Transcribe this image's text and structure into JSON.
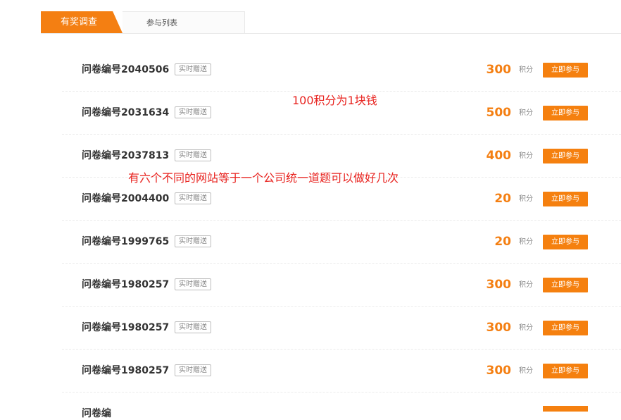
{
  "tabs": {
    "active": "有奖调查",
    "inactive": "参与列表"
  },
  "rows": [
    {
      "title": "问卷编号2040506",
      "tag": "实时赠送",
      "points": "300",
      "unit": "积分",
      "button": "立即参与"
    },
    {
      "title": "问卷编号2031634",
      "tag": "实时赠送",
      "points": "500",
      "unit": "积分",
      "button": "立即参与"
    },
    {
      "title": "问卷编号2037813",
      "tag": "实时赠送",
      "points": "400",
      "unit": "积分",
      "button": "立即参与"
    },
    {
      "title": "问卷编号2004400",
      "tag": "实时赠送",
      "points": "20",
      "unit": "积分",
      "button": "立即参与"
    },
    {
      "title": "问卷编号1999765",
      "tag": "实时赠送",
      "points": "20",
      "unit": "积分",
      "button": "立即参与"
    },
    {
      "title": "问卷编号1980257",
      "tag": "实时赠送",
      "points": "300",
      "unit": "积分",
      "button": "立即参与"
    },
    {
      "title": "问卷编号1980257",
      "tag": "实时赠送",
      "points": "300",
      "unit": "积分",
      "button": "立即参与"
    },
    {
      "title": "问卷编号1980257",
      "tag": "实时赠送",
      "points": "300",
      "unit": "积分",
      "button": "立即参与"
    }
  ],
  "partial_row": {
    "title": "问卷编"
  },
  "annotations": {
    "note1": "100积分为1块钱",
    "note2": "有六个不同的网站等于一个公司统一道题可以做好几次"
  },
  "colors": {
    "accent": "#f47f12",
    "annotation": "#e8231f"
  }
}
